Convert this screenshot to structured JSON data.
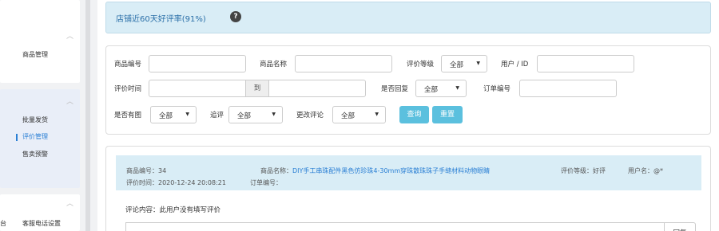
{
  "sidebar": {
    "sections": [
      {
        "items": [
          {
            "label": "商品管理"
          }
        ]
      },
      {
        "items": [
          {
            "label": "批量发货"
          },
          {
            "label": "评价管理",
            "active": true
          },
          {
            "label": "售卖预警"
          }
        ]
      },
      {
        "items": [
          {
            "label": "台",
            "clipped": true
          },
          {
            "label": "客服电话设置"
          }
        ]
      }
    ]
  },
  "banner": {
    "text": "店铺近60天好评率(91%)",
    "help_glyph": "?"
  },
  "filters": {
    "product_no_label": "商品编号",
    "product_name_label": "商品名称",
    "rating_level_label": "评价等级",
    "rating_level_value": "全部",
    "user_label": "用户 / ID",
    "review_time_label": "评价时间",
    "to_label": "到",
    "replied_label": "是否回复",
    "replied_value": "全部",
    "order_no_label": "订单编号",
    "has_image_label": "是否有图",
    "has_image_value": "全部",
    "followup_label": "追评",
    "followup_value": "全部",
    "changed_label": "更改评论",
    "changed_value": "全部",
    "query_button": "查询",
    "reset_button": "重置"
  },
  "review": {
    "product_no_label": "商品编号：",
    "product_no": "34",
    "product_name_label": "商品名称：",
    "product_name": "DIY手工串珠配件黑色仿珍珠4-30mm穿珠散珠珠子手缝材料动物眼睛",
    "rating_label": "评价等级：",
    "rating": "好评",
    "username_label": "用户名：",
    "username": "@*",
    "time_label": "评价时间：",
    "time": "2020-12-24 20:08:21",
    "order_label": "订单编号：",
    "order": "",
    "content_label": "评论内容：",
    "content": "此用户没有填写评价",
    "reply_button": "回复"
  },
  "colors": {
    "accent": "#2a7fd4",
    "banner_bg": "#d9edf6",
    "button_bg": "#5bc0de"
  }
}
